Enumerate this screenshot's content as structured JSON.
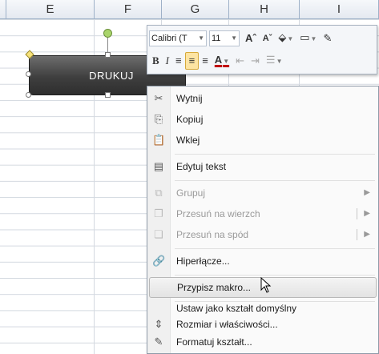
{
  "columns": [
    "E",
    "F",
    "G",
    "H",
    "I"
  ],
  "shape": {
    "label": "DRUKUJ"
  },
  "mini_toolbar": {
    "font_name": "Calibri (T",
    "font_size": "11",
    "grow_font": "Aˆ",
    "shrink_font": "Aˇ",
    "bold": "B",
    "italic": "I"
  },
  "menu": {
    "items": [
      {
        "label": "Wytnij",
        "icon": "scissors-icon",
        "disabled": false
      },
      {
        "label": "Kopiuj",
        "icon": "copy-icon",
        "disabled": false
      },
      {
        "label": "Wklej",
        "icon": "paste-icon",
        "disabled": false
      },
      {
        "label": "Edytuj tekst",
        "icon": "edit-text-icon",
        "disabled": false
      },
      {
        "label": "Grupuj",
        "icon": "group-icon",
        "disabled": true
      },
      {
        "label": "Przesuń na wierzch",
        "icon": "bring-front-icon",
        "disabled": true
      },
      {
        "label": "Przesuń na spód",
        "icon": "send-back-icon",
        "disabled": true
      },
      {
        "label": "Hiperłącze...",
        "icon": "hyperlink-icon",
        "disabled": false
      },
      {
        "label": "Przypisz makro...",
        "icon": "",
        "disabled": false
      },
      {
        "label": "Ustaw jako kształt domyślny",
        "icon": "",
        "disabled": false
      },
      {
        "label": "Rozmiar i właściwości...",
        "icon": "size-properties-icon",
        "disabled": false
      },
      {
        "label": "Formatuj kształt...",
        "icon": "format-shape-icon",
        "disabled": false
      }
    ]
  },
  "colors": {
    "hover_item": "#e3e3e3",
    "shape_fill": "#3f3f3f",
    "header_border": "#9eb1c8"
  }
}
